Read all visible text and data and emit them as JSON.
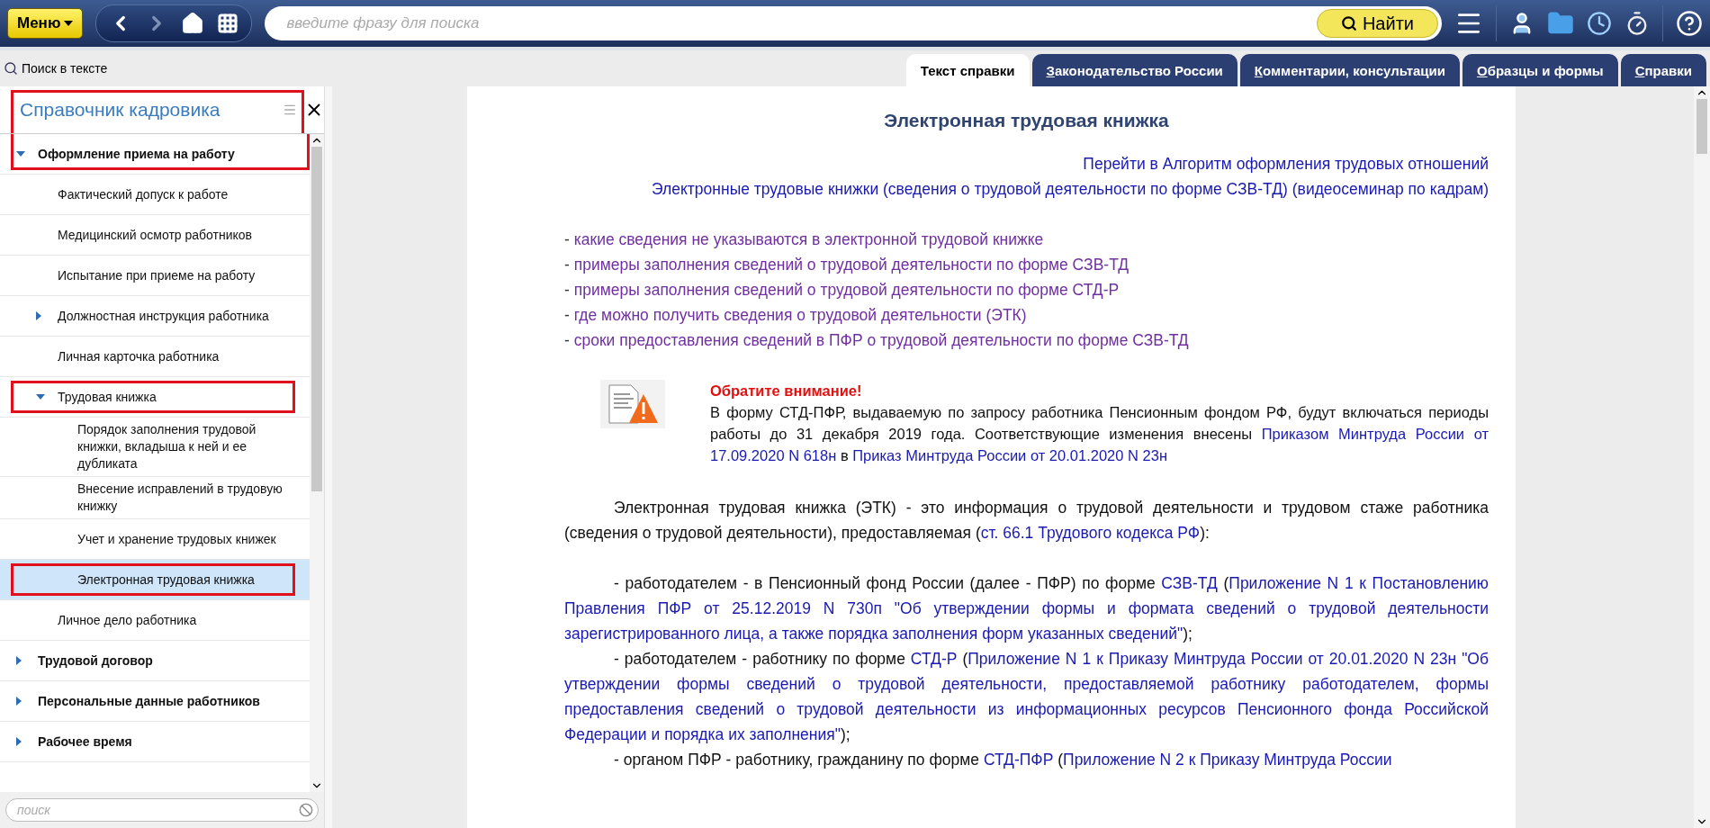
{
  "top_bar": {
    "menu_button": "Меню",
    "search": {
      "placeholder": "введите фразу для поиска"
    },
    "find_button": "Найти"
  },
  "text_search": "Поиск в тексте",
  "tabs": [
    {
      "label": "Текст справки",
      "selected": true,
      "accel": false
    },
    {
      "label": "Законодательство России",
      "selected": false,
      "accel": true
    },
    {
      "label": "Комментарии, консультации",
      "selected": false,
      "accel": true
    },
    {
      "label": "Образцы и формы",
      "selected": false,
      "accel": true
    },
    {
      "label": "Справки",
      "selected": false,
      "accel": true
    }
  ],
  "sidebar": {
    "title": "Справочник кадровика",
    "title_highlighted": true,
    "items": [
      {
        "label": "Оформление приема на работу",
        "expanded": true,
        "highlighted": true,
        "selected": false,
        "children": [
          {
            "label": "Фактический допуск к работе",
            "highlighted": false,
            "selected": false
          },
          {
            "label": "Медицинский осмотр работников",
            "highlighted": false,
            "selected": false
          },
          {
            "label": "Испытание при приеме на работу",
            "highlighted": false,
            "selected": false
          },
          {
            "label": "Должностная инструкция работника",
            "expanded": false,
            "highlighted": false,
            "selected": false
          },
          {
            "label": "Личная карточка работника",
            "highlighted": false,
            "selected": false
          },
          {
            "label": "Трудовая книжка",
            "expanded": true,
            "highlighted": true,
            "selected": false,
            "children": [
              {
                "label": "Порядок заполнения трудовой книжки, вкладыша к ней и ее дубликата",
                "highlighted": false,
                "selected": false
              },
              {
                "label": "Внесение исправлений в трудовую книжку",
                "highlighted": false,
                "selected": false
              },
              {
                "label": "Учет и хранение трудовых книжек",
                "highlighted": false,
                "selected": false
              },
              {
                "label": "Электронная трудовая книжка",
                "highlighted": true,
                "selected": true
              }
            ]
          },
          {
            "label": "Личное дело работника",
            "highlighted": false,
            "selected": false
          }
        ]
      },
      {
        "label": "Трудовой договор",
        "expanded": false,
        "highlighted": false,
        "selected": false
      },
      {
        "label": "Персональные данные работников",
        "expanded": false,
        "highlighted": false,
        "selected": false
      },
      {
        "label": "Рабочее время",
        "expanded": false,
        "highlighted": false,
        "selected": false
      }
    ],
    "search": {
      "placeholder": "поиск"
    }
  },
  "document": {
    "title": "Электронная трудовая книжка",
    "top_links": [
      "Перейти в Алгоритм оформления трудовых отношений",
      "Электронные трудовые книжки (сведения о трудовой деятельности по форме СЗВ-ТД) (видеосеминар по кадрам)"
    ],
    "bullet_links": [
      {
        "dash": "-",
        "text": "какие сведения не указываются в электронной трудовой книжке"
      },
      {
        "dash": "-",
        "text": "примеры заполнения сведений о трудовой деятельности по форме СЗВ-ТД"
      },
      {
        "dash": "-",
        "text": "примеры заполнения сведений о трудовой деятельности по форме СТД-Р"
      },
      {
        "dash": "-",
        "text": "где можно получить сведения о трудовой деятельности (ЭТК)"
      },
      {
        "dash": "-",
        "text": "сроки предоставления сведений в ПФР о трудовой деятельности по форме СЗВ-ТД"
      }
    ],
    "notice": {
      "heading": "Обратите внимание!",
      "body": [
        {
          "text": "В форму СТД-ПФР, выдаваемую по запросу работника Пенсионным фондом РФ, будут включаться периоды работы до 31 декабря 2019 года. Соответствующие изменения внесены ",
          "kind": "text"
        },
        {
          "text": "Приказом Минтруда России от 17.09.2020 N 618н",
          "kind": "link"
        },
        {
          "text": " в ",
          "kind": "text"
        },
        {
          "text": "Приказ Минтруда России от 20.01.2020 N 23н",
          "kind": "link"
        }
      ]
    },
    "paragraphs": [
      {
        "gap": false,
        "parts": [
          {
            "text": "Электронная трудовая книжка (ЭТК) - это информация о трудовой деятельности и трудовом стаже работника (сведения о трудовой деятельности), предоставляемая (",
            "kind": "text"
          },
          {
            "text": "ст. 66.1 Трудового кодекса РФ",
            "kind": "link"
          },
          {
            "text": "):",
            "kind": "text"
          }
        ]
      },
      {
        "gap": true,
        "parts": [
          {
            "text": "- работодателем - в Пенсионный фонд России (далее - ПФР) по форме ",
            "kind": "text"
          },
          {
            "text": "СЗВ-ТД",
            "kind": "link"
          },
          {
            "text": " (",
            "kind": "text"
          },
          {
            "text": "Приложение N 1 к Постановлению Правления ПФР от 25.12.2019 N 730п \"Об утверждении формы и формата сведений о трудовой деятельности зарегистрированного лица, а также порядка заполнения форм указанных сведений\"",
            "kind": "link"
          },
          {
            "text": ");",
            "kind": "text"
          }
        ]
      },
      {
        "gap": false,
        "parts": [
          {
            "text": "- работодателем - работнику по форме ",
            "kind": "text"
          },
          {
            "text": "СТД-Р",
            "kind": "link"
          },
          {
            "text": " (",
            "kind": "text"
          },
          {
            "text": "Приложение N 1 к Приказу Минтруда России от 20.01.2020 N 23н \"Об утверждении формы сведений о трудовой деятельности, предоставляемой работнику работодателем, формы предоставления сведений о трудовой деятельности из информационных ресурсов Пенсионного фонда Российской Федерации и порядка их заполнения\"",
            "kind": "link"
          },
          {
            "text": ");",
            "kind": "text"
          }
        ]
      },
      {
        "gap": false,
        "parts": [
          {
            "text": "- органом ПФР - работнику, гражданину по форме ",
            "kind": "text"
          },
          {
            "text": "СТД-ПФР",
            "kind": "link"
          },
          {
            "text": " (",
            "kind": "text"
          },
          {
            "text": "Приложение N 2 к Приказу Минтруда России",
            "kind": "link"
          }
        ]
      }
    ]
  }
}
